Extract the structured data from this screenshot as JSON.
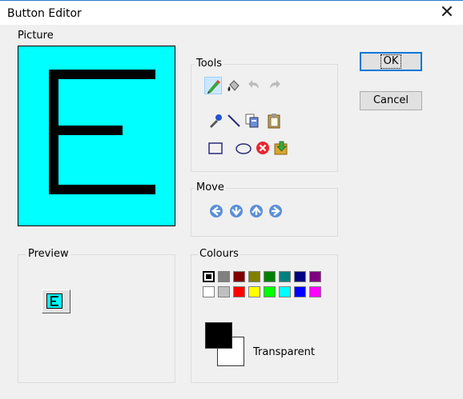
{
  "window": {
    "title": "Button Editor",
    "close_glyph": "✕"
  },
  "picture": {
    "label": "Picture",
    "background": "#00ffff",
    "glyph": "E"
  },
  "tools": {
    "title": "Tools",
    "items": [
      {
        "name": "pencil-icon",
        "active": true
      },
      {
        "name": "fill-bucket-icon"
      },
      {
        "name": "undo-icon",
        "disabled": true
      },
      {
        "name": "redo-icon",
        "disabled": true
      },
      {
        "name": "eyedropper-icon"
      },
      {
        "name": "line-icon"
      },
      {
        "name": "copy-icon"
      },
      {
        "name": "paste-icon"
      },
      {
        "name": "rectangle-icon"
      },
      {
        "name": "ellipse-icon"
      },
      {
        "name": "clear-icon"
      },
      {
        "name": "import-icon"
      }
    ]
  },
  "move": {
    "title": "Move",
    "items": [
      "move-left-icon",
      "move-down-icon",
      "move-up-icon",
      "move-right-icon"
    ]
  },
  "buttons": {
    "ok": "OK",
    "cancel": "Cancel"
  },
  "preview": {
    "title": "Preview",
    "glyph": "E"
  },
  "colours": {
    "title": "Colours",
    "row1": [
      "#000000",
      "#808080",
      "#800000",
      "#808000",
      "#008000",
      "#008080",
      "#000080",
      "#800080"
    ],
    "row2": [
      "#ffffff",
      "#c0c0c0",
      "#ff0000",
      "#ffff00",
      "#00ff00",
      "#00ffff",
      "#0000ff",
      "#ff00ff"
    ],
    "selected_foreground": "#000000",
    "selected_background": "#ffffff",
    "transparent_label": "Transparent"
  }
}
